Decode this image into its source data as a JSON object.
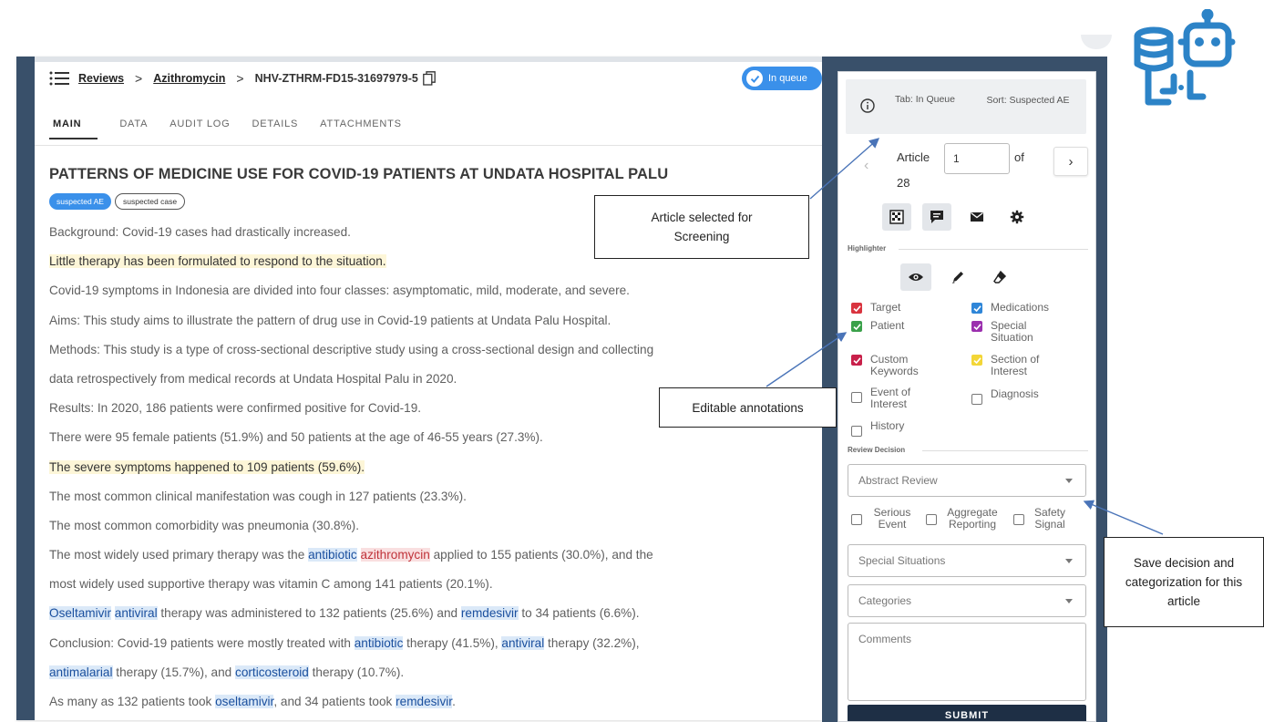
{
  "breadcrumb": {
    "root": "Reviews",
    "product": "Azithromycin",
    "case_id": "NHV-ZTHRM-FD15-31697979-5"
  },
  "status": {
    "label": "In queue",
    "color": "#3a90ea"
  },
  "tabs": [
    "MAIN",
    "DATA",
    "AUDIT LOG",
    "DETAILS",
    "ATTACHMENTS"
  ],
  "article": {
    "title": "PATTERNS OF MEDICINE USE FOR COVID-19 PATIENTS AT UNDATA HOSPITAL PALU",
    "tags": [
      "suspected AE",
      "suspected case"
    ],
    "lines": [
      [
        {
          "t": "Background: Covid-19 cases had drastically increased."
        }
      ],
      [
        {
          "t": "Little therapy has been formulated to respond to the situation.",
          "h": "y"
        }
      ],
      [
        {
          "t": "Covid-19 symptoms in Indonesia are divided into four classes: asymptomatic, mild, moderate, and severe."
        }
      ],
      [
        {
          "t": "Aims: This study aims to illustrate the pattern of drug use in Covid-19 patients at Undata Palu Hospital."
        }
      ],
      [
        {
          "t": "Methods: This study is a type of cross-sectional descriptive study using a cross-sectional design and collecting"
        }
      ],
      [
        {
          "t": "data retrospectively from medical records at Undata Hospital Palu in 2020."
        }
      ],
      [
        {
          "t": "Results: In 2020, 186 patients were confirmed positive for Covid-19."
        }
      ],
      [
        {
          "t": "There were 95 female patients (51.9%) and 50 patients at the age of 46-55 years (27.3%)."
        }
      ],
      [
        {
          "t": "The severe symptoms happened to 109 patients (59.6%).",
          "h": "y"
        }
      ],
      [
        {
          "t": "The most common clinical manifestation was cough in 127 patients (23.3%)."
        }
      ],
      [
        {
          "t": "The most common comorbidity was pneumonia (30.8%)."
        }
      ],
      [
        {
          "t": "The most widely used primary therapy was the "
        },
        {
          "t": "antibiotic",
          "h": "b"
        },
        {
          "t": " "
        },
        {
          "t": "azithromycin",
          "h": "r"
        },
        {
          "t": " applied to 155 patients (30.0%), and the"
        }
      ],
      [
        {
          "t": "most widely used supportive therapy was vitamin C among 141 patients (20.1%)."
        }
      ],
      [
        {
          "t": "Oseltamivir",
          "h": "b"
        },
        {
          "t": " "
        },
        {
          "t": "antiviral",
          "h": "b"
        },
        {
          "t": " therapy was administered to 132 patients (25.6%) and "
        },
        {
          "t": "remdesivir",
          "h": "b"
        },
        {
          "t": " to 34 patients (6.6%)."
        }
      ],
      [
        {
          "t": "Conclusion: Covid-19 patients were mostly treated with "
        },
        {
          "t": "antibiotic",
          "h": "b"
        },
        {
          "t": " therapy (41.5%), "
        },
        {
          "t": "antiviral",
          "h": "b"
        },
        {
          "t": " therapy (32.2%),"
        }
      ],
      [
        {
          "t": "antimalarial",
          "h": "b"
        },
        {
          "t": " therapy (15.7%), and "
        },
        {
          "t": "corticosteroid",
          "h": "b"
        },
        {
          "t": " therapy (10.7%)."
        }
      ],
      [
        {
          "t": "As many as 132 patients took "
        },
        {
          "t": "oseltamivir",
          "h": "b"
        },
        {
          "t": ", and 34 patients took "
        },
        {
          "t": "remdesivir",
          "h": "b"
        },
        {
          "t": "."
        }
      ]
    ]
  },
  "sidebar": {
    "tab_info": "Tab: In Queue",
    "sort_info": "Sort: Suspected AE",
    "pager": {
      "label": "Article",
      "value": "1",
      "of": "of",
      "total": "28"
    },
    "mode_icons": [
      "grid-icon",
      "comment-icon",
      "mail-icon",
      "gear-icon"
    ],
    "highlighter_label": "Highlighter",
    "highlighter_tools": [
      "eye-icon",
      "pen-icon",
      "eraser-icon"
    ],
    "categories_left": [
      {
        "label": "Target",
        "checked": true,
        "color": "#d9343f"
      },
      {
        "label": "Patient",
        "checked": true,
        "color": "#3aa14a"
      },
      {
        "label": "Custom Keywords",
        "checked": true,
        "color": "#c8204a"
      },
      {
        "label": "Event of Interest",
        "checked": false,
        "color": ""
      },
      {
        "label": "History",
        "checked": false,
        "color": ""
      }
    ],
    "categories_right": [
      {
        "label": "Medications",
        "checked": true,
        "color": "#2f86d8"
      },
      {
        "label": "Special Situation",
        "checked": true,
        "color": "#9b2fae"
      },
      {
        "label": "Section of Interest",
        "checked": true,
        "color": "#f3d637"
      },
      {
        "label": "Diagnosis",
        "checked": false,
        "color": ""
      }
    ],
    "review_decision_label": "Review Decision",
    "review_select": "Abstract Review",
    "flags": [
      {
        "label": "Serious Event",
        "checked": false
      },
      {
        "label": "Aggregate Reporting",
        "checked": false
      },
      {
        "label": "Safety Signal",
        "checked": false
      }
    ],
    "special_select": "Special Situations",
    "categories_select": "Categories",
    "comments_placeholder": "Comments",
    "submit_label": "SUBMIT"
  },
  "annotations": {
    "article_selected": "Article selected for Screening",
    "editable": "Editable annotations",
    "save_decision": "Save decision and categorization for this article"
  },
  "colors": {
    "frame": "#39506a",
    "accent": "#3a90ea",
    "logo": "#2c83c7"
  }
}
